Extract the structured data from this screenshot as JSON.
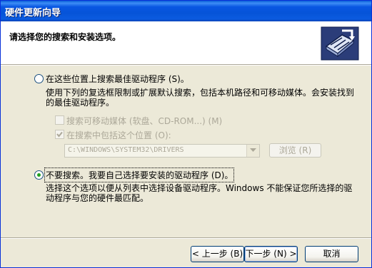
{
  "window": {
    "title": "硬件更新向导"
  },
  "header": {
    "title": "请选择您的搜索和安装选项。",
    "icon": "hardware-wizard-icon"
  },
  "option_search": {
    "label": "在这些位置上搜索最佳驱动程序 (S)。",
    "description": "使用下列的复选框限制或扩展默认搜索，包括本机路径和可移动媒体。会安装找到的最佳驱动程序。",
    "selected": false
  },
  "check_removable": {
    "label": "搜索可移动媒体 (软盘、CD-ROM...) (M)",
    "checked": false
  },
  "check_include": {
    "label": "在搜索中包括这个位置 (O):",
    "checked": true
  },
  "path": {
    "value": "C:\\WINDOWS\\SYSTEM32\\DRIVERS"
  },
  "browse": {
    "label": "浏览 (R)"
  },
  "option_manual": {
    "label": "不要搜索。我要自己选择要安装的驱动程序 (D)。",
    "description": "选择这个选项以便从列表中选择设备驱动程序。Windows 不能保证您所选择的驱动程序与您的硬件最匹配。",
    "selected": true
  },
  "footer": {
    "back": "< 上一步 (B)",
    "next": "下一步 (N) >",
    "cancel": "取消"
  },
  "colors": {
    "titlebar": "#0a5ed8",
    "dialog_bg": "#ece9d8",
    "button_border": "#003c74",
    "radio_dot": "#21a121"
  }
}
